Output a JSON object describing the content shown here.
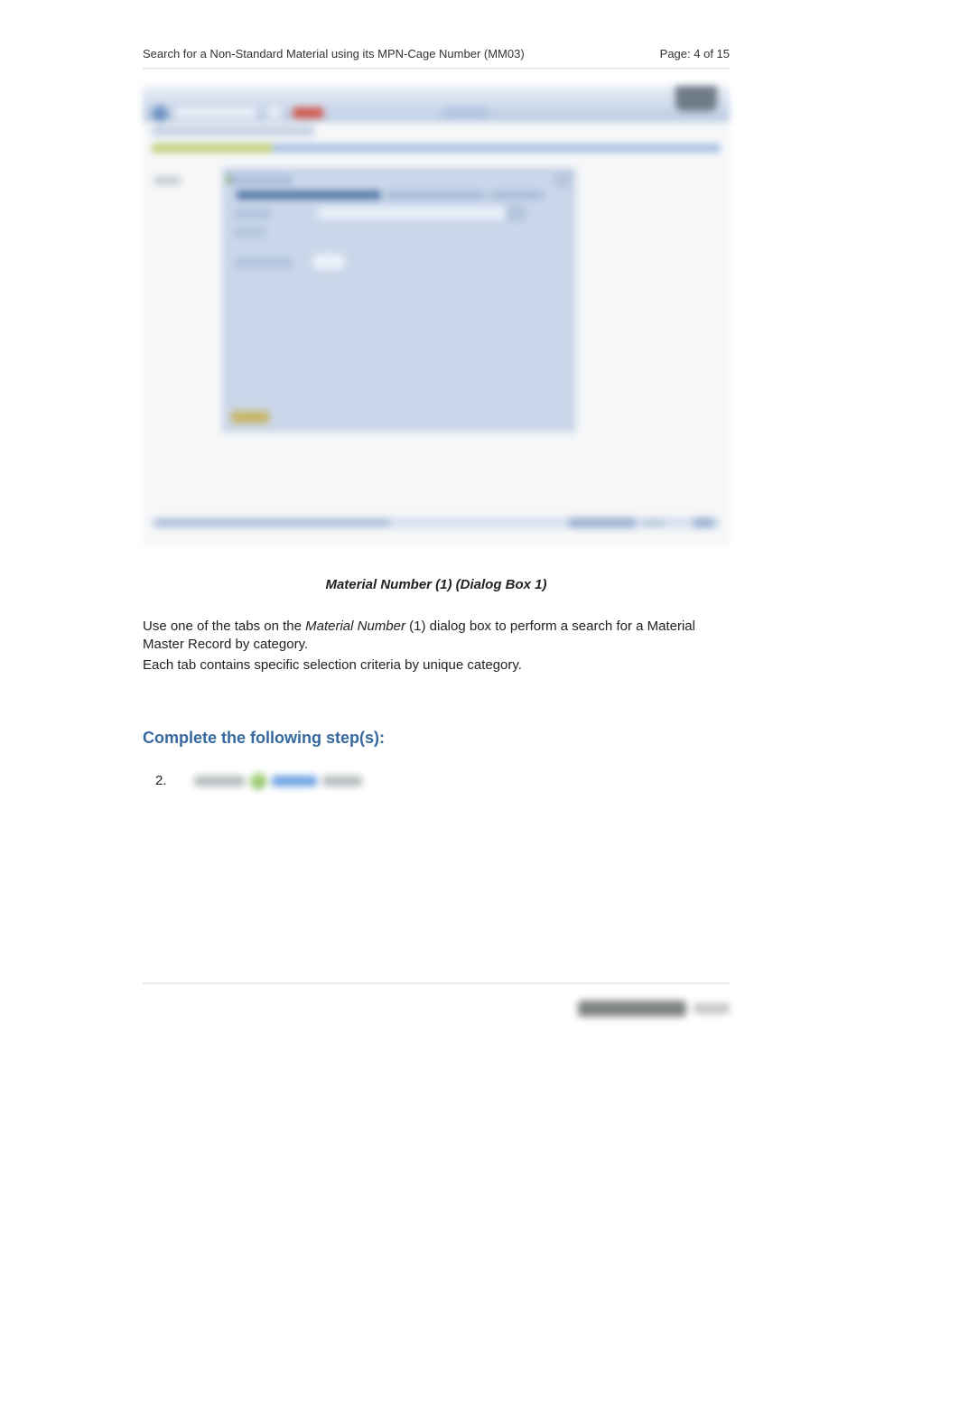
{
  "header": {
    "title": "Search for a Non-Standard Material using its MPN-Cage Number (MM03)",
    "page_label": "Page: 4 of 15"
  },
  "caption": "Material Number (1) (Dialog Box 1)",
  "paragraph1_pre": "Use one of the tabs on the  ",
  "paragraph1_ital": "Material Number",
  "paragraph1_post": " (1) dialog box to perform a search for a Material Master Record by category.",
  "paragraph2": "Each tab contains specific selection criteria by unique category.",
  "section_heading": "Complete the following step(s):",
  "step_number": "2."
}
